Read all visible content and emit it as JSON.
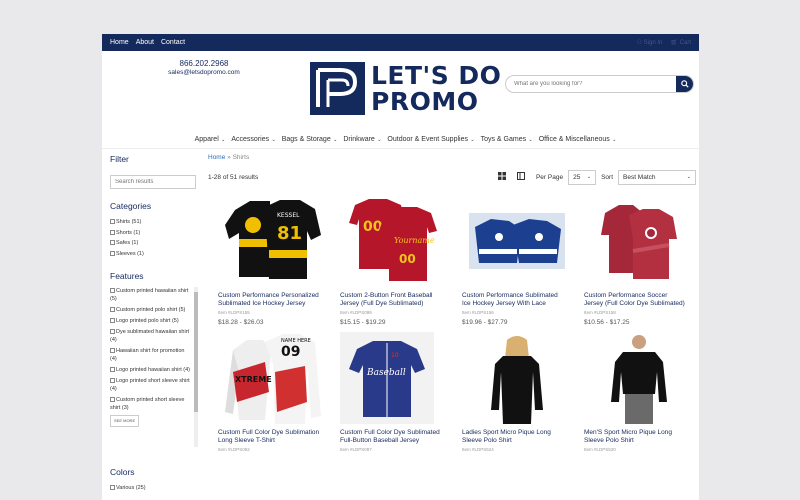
{
  "topbar": {
    "links": [
      "Home",
      "About",
      "Contact"
    ],
    "signin": "Sign In",
    "cart": "Cart"
  },
  "header": {
    "phone": "866.202.2968",
    "email": "sales@letsdopromo.com",
    "logo_line1": "LET'S DO",
    "logo_line2": "PROMO",
    "search_placeholder": "What are you looking for?"
  },
  "nav": [
    "Apparel",
    "Accessories",
    "Bags & Storage",
    "Drinkware",
    "Outdoor & Event Supplies",
    "Toys & Games",
    "Office & Miscellaneous"
  ],
  "sidebar": {
    "filter_title": "Filter",
    "search_placeholder": "Search results",
    "categories_title": "Categories",
    "categories": [
      "Shirts (51)",
      "Shorts (1)",
      "Safes (1)",
      "Sleeves (1)"
    ],
    "features_title": "Features",
    "features": [
      "Custom printed hawaiian shirt (5)",
      "Custom printed polo shirt (5)",
      "Logo printed polo shirt (5)",
      "Dye sublimated hawaiian shirt (4)",
      "Hawaiian shirt for promotion (4)",
      "Logo printed hawaiian shirt (4)",
      "Logo printed short sleeve shirt (4)",
      "Custom printed short sleeve shirt (3)"
    ],
    "see_more": "SEE MORE",
    "colors_title": "Colors",
    "colors": [
      "Various (25)"
    ]
  },
  "main": {
    "breadcrumb_home": "Home",
    "breadcrumb_sep": "»",
    "breadcrumb_current": "Shirts",
    "results": "1-28 of 51 results",
    "per_page_label": "Per Page",
    "per_page": "25",
    "sort_label": "Sort",
    "sort": "Best Match"
  },
  "products": [
    {
      "name": "Custom Performance Personalized Sublimated Ice Hockey Jersey",
      "item": "Item #LDPS155",
      "price": "$18.28 - $26.03",
      "icon": "hockey-jersey-black-yellow"
    },
    {
      "name": "Custom 2-Button Front Baseball Jersey (Full Dye Sublimated)",
      "item": "Item #LDPS099",
      "price": "$15.15 - $19.29",
      "icon": "baseball-jersey-red"
    },
    {
      "name": "Custom Performance Sublimated Ice Hockey Jersey With Lace",
      "item": "Item #LDPS156",
      "price": "$19.96 - $27.79",
      "icon": "hockey-jersey-blue"
    },
    {
      "name": "Custom Performance Soccer Jersey (Full Color Dye Sublimated)",
      "item": "Item #LDPS158",
      "price": "$10.56 - $17.25",
      "icon": "soccer-jersey-red"
    },
    {
      "name": "Custom Full Color Dye Sublimation Long Sleeve T-Shirt",
      "item": "Item #LDPS092",
      "price": "",
      "icon": "long-sleeve-tee-red"
    },
    {
      "name": "Custom Full Color Dye Sublimated Full-Button Baseball Jersey",
      "item": "Item #LDPS097",
      "price": "",
      "icon": "baseball-jersey-navy"
    },
    {
      "name": "Ladies Sport Micro Pique Long Sleeve Polo Shirt",
      "item": "Item #LDPS524",
      "price": "",
      "icon": "ladies-polo-black"
    },
    {
      "name": "Men'S Sport Micro Pique Long Sleeve Polo Shirt",
      "item": "Item #LDPS520",
      "price": "",
      "icon": "mens-polo-black"
    }
  ],
  "colors": {
    "brand": "#14295c",
    "link": "#2a6ebb"
  }
}
